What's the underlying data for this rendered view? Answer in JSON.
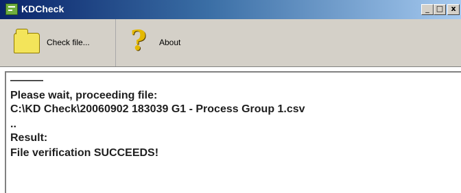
{
  "window": {
    "title": "KDCheck",
    "controls": {
      "minimize": "_",
      "maximize": "□",
      "close": "x"
    }
  },
  "toolbar": {
    "check_file_label": "Check file...",
    "about_label": "About"
  },
  "output": {
    "lines": [
      "———",
      "Please wait, proceeding file:",
      "C:\\KD Check\\20060902 183039 G1 - Process Group 1.csv",
      "..",
      "Result:",
      "File verification SUCCEEDS!"
    ]
  },
  "icons": {
    "app": "kdcheck-app-icon",
    "check_file": "folder-icon",
    "about": "help-icon"
  },
  "colors": {
    "titlebar_start": "#0a246a",
    "titlebar_end": "#a6caf0",
    "toolbar_bg": "#d4d0c8",
    "folder": "#f3e45a",
    "help": "#e4b800"
  }
}
